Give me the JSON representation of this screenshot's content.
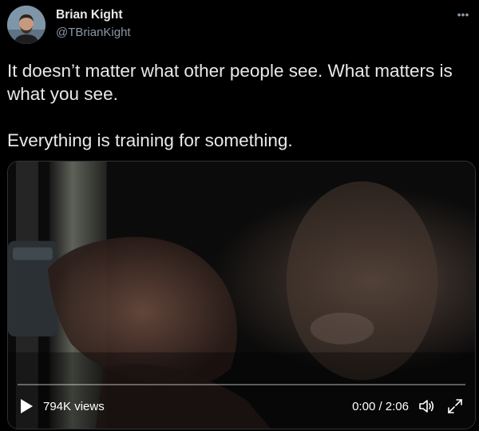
{
  "author": {
    "display_name": "Brian Kight",
    "handle": "@TBrianKight"
  },
  "tweet": {
    "paragraphs": [
      "It doesn’t matter what other people see. What matters is what you see.",
      "Everything is training for something."
    ]
  },
  "video": {
    "views": "794K views",
    "time": "0:00 / 2:06",
    "progress": 0
  },
  "icons": {
    "more": "more-horizontal-icon",
    "play": "play-icon",
    "volume": "volume-icon",
    "fullscreen": "fullscreen-icon"
  },
  "colors": {
    "background": "#000000",
    "text_primary": "#e7e9ea",
    "text_secondary": "#8b98a5",
    "accent": "#1d9bf0"
  }
}
